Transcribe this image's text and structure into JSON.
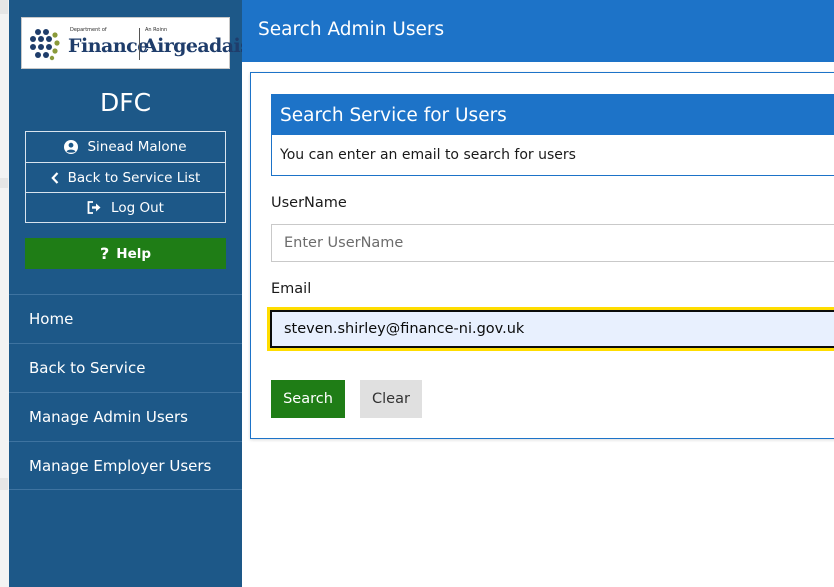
{
  "logo": {
    "dept_small": "Department of",
    "an_roinn_small": "An Roinn",
    "finance": "Finance",
    "airgeadais": "Airgeadais"
  },
  "sidebar": {
    "title": "DFC",
    "user": {
      "name": "Sinead Malone",
      "back_to_service_list": "Back to Service List",
      "log_out": "Log Out"
    },
    "help": "Help",
    "nav": [
      {
        "label": "Home"
      },
      {
        "label": "Back to Service"
      },
      {
        "label": "Manage Admin Users"
      },
      {
        "label": "Manage Employer Users"
      }
    ]
  },
  "header": {
    "title": "Search Admin Users"
  },
  "search_card": {
    "title": "Search Service for Users",
    "description": "You can enter an email to search for users"
  },
  "form": {
    "username_label": "UserName",
    "username_placeholder": "Enter UserName",
    "username_value": "",
    "email_label": "Email",
    "email_value": "steven.shirley@finance-ni.gov.uk",
    "search_button": "Search",
    "clear_button": "Clear"
  },
  "colors": {
    "sidebar_bg": "#1d5888",
    "header_blue": "#1d73c8",
    "button_green": "#1f7d16",
    "focus_yellow": "#ffdd00"
  },
  "icons": {
    "user": "user-circle-icon",
    "back": "chevron-left-icon",
    "logout": "sign-out-icon",
    "help": "question-mark-icon"
  }
}
